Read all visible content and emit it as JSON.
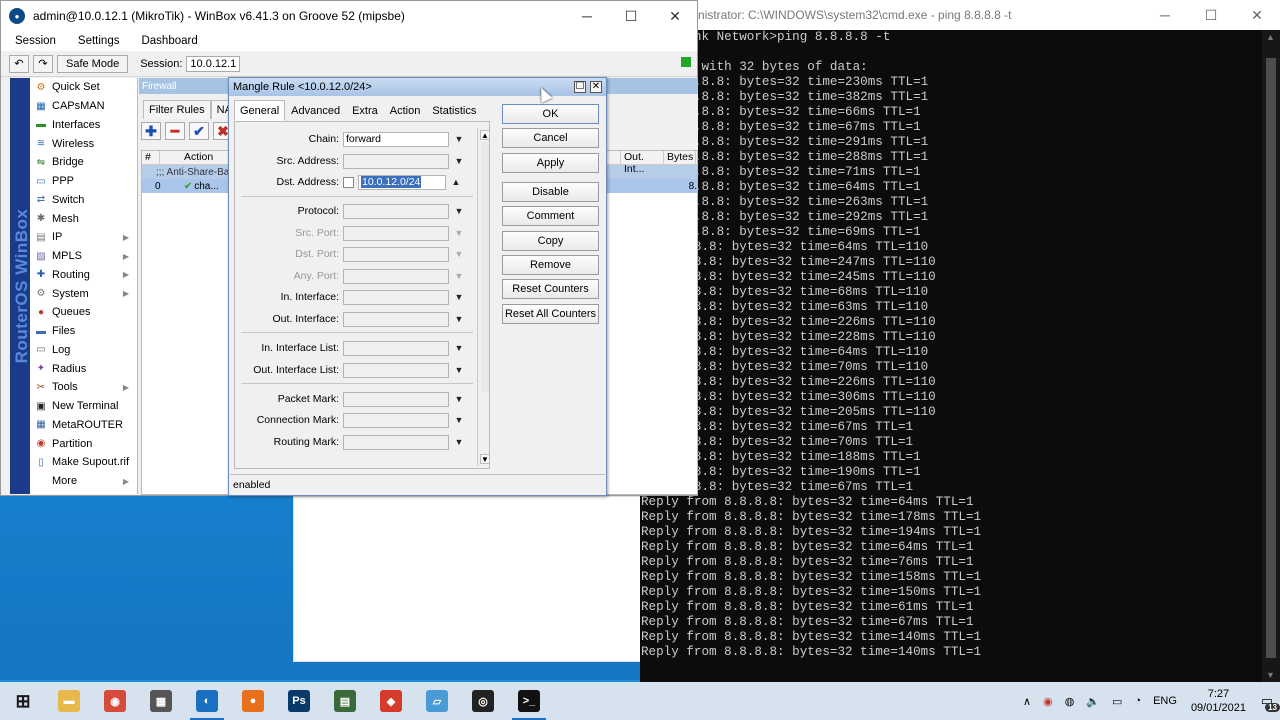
{
  "winbox": {
    "title": "admin@10.0.12.1 (MikroTik) - WinBox v6.41.3 on Groove 52 (mipsbe)",
    "controls": [
      "─",
      "☐",
      "✕"
    ],
    "menu": [
      "Session",
      "Settings",
      "Dashboard"
    ],
    "toolbar": {
      "undo": "↶",
      "redo": "↷",
      "safe_mode": "Safe Mode",
      "session_label": "Session:",
      "session_value": "10.0.12.1"
    },
    "brand_strip": "RouterOS WinBox",
    "sidebar": [
      {
        "label": "Quick Set",
        "icon": "⚙",
        "color": "#c77a1a",
        "arrow": ""
      },
      {
        "label": "CAPsMAN",
        "icon": "▦",
        "color": "#1a5fb0",
        "arrow": ""
      },
      {
        "label": "Interfaces",
        "icon": "▬",
        "color": "#2a8f2a",
        "arrow": ""
      },
      {
        "label": "Wireless",
        "icon": "≋",
        "color": "#3a6ac0",
        "arrow": ""
      },
      {
        "label": "Bridge",
        "icon": "⇋",
        "color": "#2b7a2b",
        "arrow": ""
      },
      {
        "label": "PPP",
        "icon": "▭",
        "color": "#3070b8",
        "arrow": ""
      },
      {
        "label": "Switch",
        "icon": "⇄",
        "color": "#4a6fa5",
        "arrow": ""
      },
      {
        "label": "Mesh",
        "icon": "✱",
        "color": "#6a6a6a",
        "arrow": ""
      },
      {
        "label": "IP",
        "icon": "▤",
        "color": "#777",
        "arrow": "▶"
      },
      {
        "label": "MPLS",
        "icon": "▨",
        "color": "#6a6aa8",
        "arrow": "▶"
      },
      {
        "label": "Routing",
        "icon": "✚",
        "color": "#2a5fb0",
        "arrow": "▶"
      },
      {
        "label": "System",
        "icon": "⚙",
        "color": "#777",
        "arrow": "▶"
      },
      {
        "label": "Queues",
        "icon": "●",
        "color": "#b83a2a",
        "arrow": ""
      },
      {
        "label": "Files",
        "icon": "▬",
        "color": "#3a6ab8",
        "arrow": ""
      },
      {
        "label": "Log",
        "icon": "▭",
        "color": "#666",
        "arrow": ""
      },
      {
        "label": "Radius",
        "icon": "✦",
        "color": "#8a3aa8",
        "arrow": ""
      },
      {
        "label": "Tools",
        "icon": "✂",
        "color": "#a04020",
        "arrow": "▶"
      },
      {
        "label": "New Terminal",
        "icon": "▣",
        "color": "#222",
        "arrow": ""
      },
      {
        "label": "MetaROUTER",
        "icon": "▦",
        "color": "#3060a0",
        "arrow": ""
      },
      {
        "label": "Partition",
        "icon": "◉",
        "color": "#c0392b",
        "arrow": ""
      },
      {
        "label": "Make Supout.rif",
        "icon": "▯",
        "color": "#3a6ab8",
        "arrow": ""
      },
      {
        "label": "More",
        "icon": "",
        "color": "#000",
        "arrow": "▶"
      }
    ]
  },
  "firewall": {
    "title": "Firewall",
    "tabs": [
      "Filter Rules",
      "NAT"
    ],
    "tools": {
      "add": "✚",
      "remove": "━",
      "enable": "✔",
      "disable": "✖"
    },
    "columns": [
      "#",
      "Action",
      "Out. Int...",
      "Bytes"
    ],
    "comment_row": ";;; Anti-Share-Ba",
    "row": {
      "num": "0",
      "action": "cha...",
      "bytes": "8."
    }
  },
  "mangle": {
    "title": "Mangle Rule <10.0.12.0/24>",
    "tabs": [
      "General",
      "Advanced",
      "Extra",
      "Action",
      "Statistics"
    ],
    "fields": {
      "chain_label": "Chain:",
      "chain_value": "forward",
      "src_address": "Src. Address:",
      "dst_address": "Dst. Address:",
      "dst_value": "10.0.12.0/24",
      "protocol": "Protocol:",
      "src_port": "Src. Port:",
      "dst_port": "Dst. Port:",
      "any_port": "Any. Port:",
      "in_interface": "In. Interface:",
      "out_interface": "Out. Interface:",
      "in_interface_list": "In. Interface List:",
      "out_interface_list": "Out. Interface List:",
      "packet_mark": "Packet Mark:",
      "connection_mark": "Connection Mark:",
      "routing_mark": "Routing Mark:"
    },
    "buttons": [
      "OK",
      "Cancel",
      "Apply",
      "Disable",
      "Comment",
      "Copy",
      "Remove",
      "Reset Counters",
      "Reset All Counters"
    ],
    "status": "enabled"
  },
  "cmd": {
    "title": "nistrator: C:\\WINDOWS\\system32\\cmd.exe - ping  8.8.8.8 -t",
    "controls": [
      "─",
      "☐",
      "✕"
    ],
    "lines": [
      "\\AND-Link Network>ping 8.8.8.8 -t",
      "",
      "8.8.8.8 with 32 bytes of data:",
      "rom 8.8.8.8: bytes=32 time=230ms TTL=1",
      "rom 8.8.8.8: bytes=32 time=382ms TTL=1",
      "rom 8.8.8.8: bytes=32 time=66ms TTL=1",
      "rom 8.8.8.8: bytes=32 time=67ms TTL=1",
      "rom 8.8.8.8: bytes=32 time=291ms TTL=1",
      "rom 8.8.8.8: bytes=32 time=288ms TTL=1",
      "rom 8.8.8.8: bytes=32 time=71ms TTL=1",
      "rom 8.8.8.8: bytes=32 time=64ms TTL=1",
      "rom 8.8.8.8: bytes=32 time=263ms TTL=1",
      "rom 8.8.8.8: bytes=32 time=292ms TTL=1",
      "rom 8.8.8.8: bytes=32 time=69ms TTL=1",
      "om 8.8.8.8: bytes=32 time=64ms TTL=110",
      "om 8.8.8.8: bytes=32 time=247ms TTL=110",
      "om 8.8.8.8: bytes=32 time=245ms TTL=110",
      "om 8.8.8.8: bytes=32 time=68ms TTL=110",
      "om 8.8.8.8: bytes=32 time=63ms TTL=110",
      "om 8.8.8.8: bytes=32 time=226ms TTL=110",
      "om 8.8.8.8: bytes=32 time=228ms TTL=110",
      "om 8.8.8.8: bytes=32 time=64ms TTL=110",
      "om 8.8.8.8: bytes=32 time=70ms TTL=110",
      "om 8.8.8.8: bytes=32 time=226ms TTL=110",
      "om 8.8.8.8: bytes=32 time=306ms TTL=110",
      "om 8.8.8.8: bytes=32 time=205ms TTL=110",
      "om 8.8.8.8: bytes=32 time=67ms TTL=1",
      "om 8.8.8.8: bytes=32 time=70ms TTL=1",
      "om 8.8.8.8: bytes=32 time=188ms TTL=1",
      "om 8.8.8.8: bytes=32 time=190ms TTL=1",
      "om 8.8.8.8: bytes=32 time=67ms TTL=1",
      "Reply from 8.8.8.8: bytes=32 time=64ms TTL=1",
      "Reply from 8.8.8.8: bytes=32 time=178ms TTL=1",
      "Reply from 8.8.8.8: bytes=32 time=194ms TTL=1",
      "Reply from 8.8.8.8: bytes=32 time=64ms TTL=1",
      "Reply from 8.8.8.8: bytes=32 time=76ms TTL=1",
      "Reply from 8.8.8.8: bytes=32 time=158ms TTL=1",
      "Reply from 8.8.8.8: bytes=32 time=150ms TTL=1",
      "Reply from 8.8.8.8: bytes=32 time=61ms TTL=1",
      "Reply from 8.8.8.8: bytes=32 time=67ms TTL=1",
      "Reply from 8.8.8.8: bytes=32 time=140ms TTL=1",
      "Reply from 8.8.8.8: bytes=32 time=140ms TTL=1"
    ]
  },
  "taskbar": {
    "apps": [
      {
        "name": "start-button",
        "glyph": "⊞",
        "color": "#1a1a1a",
        "active": false
      },
      {
        "name": "file-explorer-icon",
        "glyph": "▬",
        "color": "#e8b84a",
        "active": false
      },
      {
        "name": "chrome-icon",
        "glyph": "◉",
        "color": "#d64a3a",
        "active": false
      },
      {
        "name": "store-icon",
        "glyph": "▦",
        "color": "#555",
        "active": false
      },
      {
        "name": "winbox-taskbar-icon",
        "glyph": "◐",
        "color": "#1a6fc0",
        "active": true
      },
      {
        "name": "firefox-icon",
        "glyph": "●",
        "color": "#e8701a",
        "active": false
      },
      {
        "name": "photoshop-icon",
        "glyph": "Ps",
        "color": "#0a3a6a",
        "active": false
      },
      {
        "name": "app-icon",
        "glyph": "▤",
        "color": "#3a6a3a",
        "active": false
      },
      {
        "name": "app-red-icon",
        "glyph": "◆",
        "color": "#d63a2a",
        "active": false
      },
      {
        "name": "notepad-icon",
        "glyph": "▱",
        "color": "#4a9ad6",
        "active": false
      },
      {
        "name": "obs-icon",
        "glyph": "◎",
        "color": "#222",
        "active": false
      },
      {
        "name": "cmd-taskbar-icon",
        "glyph": ">_",
        "color": "#111",
        "active": true
      }
    ],
    "tray": {
      "chevron": "∧",
      "lang": "ENG",
      "time": "7:27",
      "date": "09/01/2021",
      "notifications": "13"
    }
  }
}
